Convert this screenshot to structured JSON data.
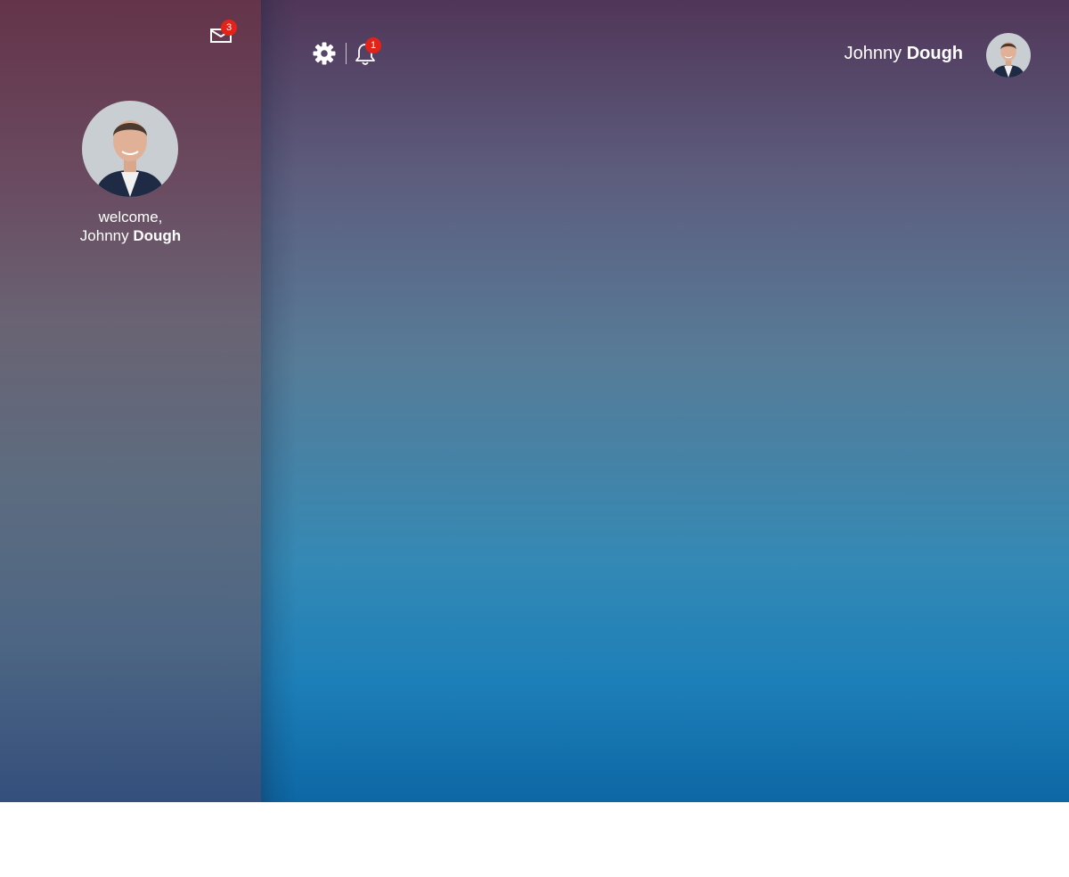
{
  "sidebar": {
    "mail_badge": "3",
    "welcome_text": "welcome,",
    "first_name": "Johnny",
    "last_name": "Dough"
  },
  "topbar": {
    "notification_badge": "1",
    "first_name": "Johnny",
    "last_name": "Dough"
  },
  "icons": {
    "mail": "mail-icon",
    "settings": "gear-icon",
    "notifications": "bell-icon",
    "avatar": "avatar"
  },
  "colors": {
    "badge": "#e2231a",
    "text": "#ffffff"
  }
}
